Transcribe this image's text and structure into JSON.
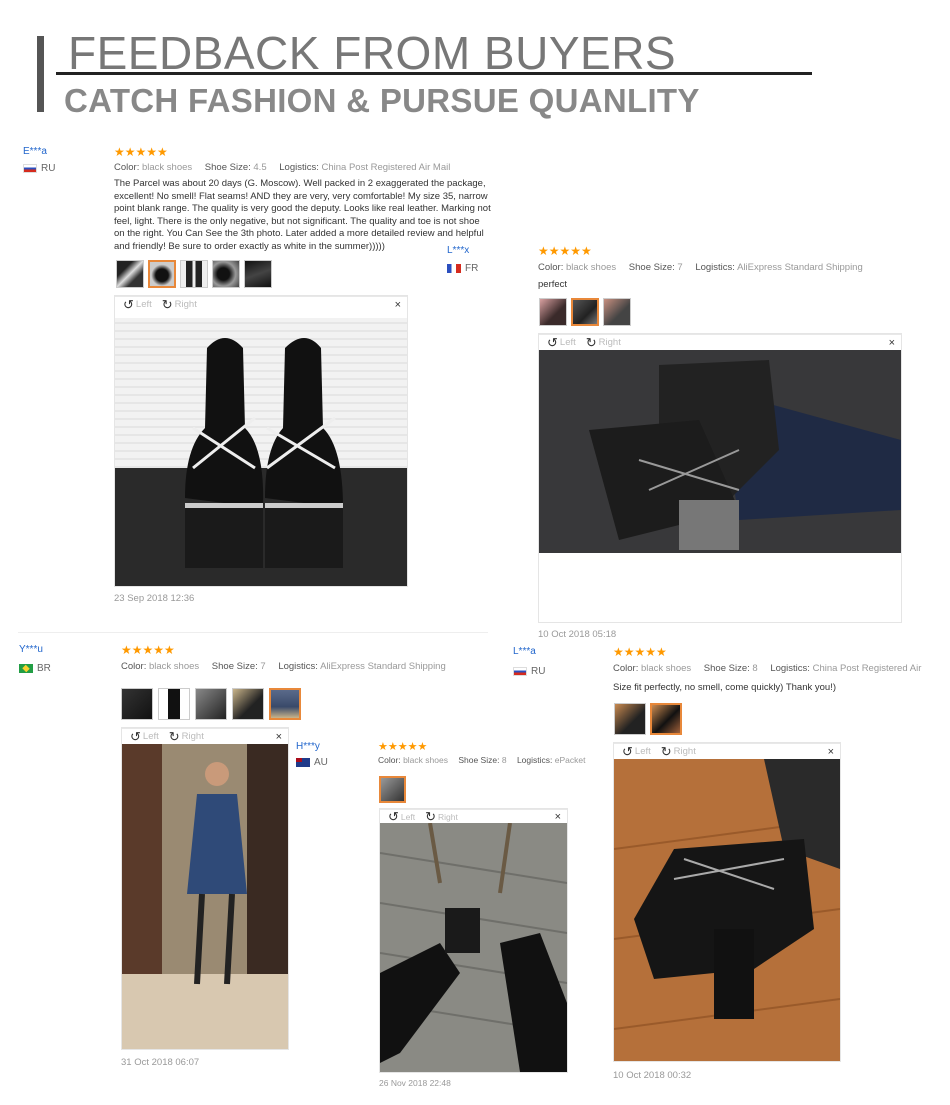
{
  "header": {
    "title": "FEEDBACK FROM BUYERS",
    "subtitle": "CATCH FASHION & PURSUE QUANLITY"
  },
  "toolbar": {
    "left": "Left",
    "right": "Right",
    "close": "×"
  },
  "stars": "★★★★★",
  "labels": {
    "color": "Color:",
    "size": "Shoe Size:",
    "logistics": "Logistics:"
  },
  "reviews": [
    {
      "user": "E***a",
      "country": "RU",
      "color": "black shoes",
      "size": "4.5",
      "logistics": "China Post Registered Air Mail",
      "text": "The Parcel was about 20 days (G. Moscow). Well packed in 2 exaggerated the package, excellent! No smell! Flat seams! AND they are very, very comfortable! My size 35, narrow point blank range. The quality is very good the deputy. Looks like real leather. Marking not feel, light. There is the only negative, but not significant. The quality and toe is not shoe on the right. You Can See the 3th photo. Later added a more detailed review and helpful and friendly! Be sure to order exactly as white in the summer)))))",
      "date": "23 Sep 2018 12:36"
    },
    {
      "user": "L***x",
      "country": "FR",
      "color": "black shoes",
      "size": "7",
      "logistics": "AliExpress Standard Shipping",
      "text": "perfect",
      "date": "10 Oct 2018 05:18"
    },
    {
      "user": "Y***u",
      "country": "BR",
      "color": "black shoes",
      "size": "7",
      "logistics": "AliExpress Standard Shipping",
      "date": "31 Oct 2018 06:07"
    },
    {
      "user": "H***y",
      "country": "AU",
      "color": "black shoes",
      "size": "8",
      "logistics": "ePacket",
      "date": "26 Nov 2018 22:48"
    },
    {
      "user": "L***a",
      "country": "RU",
      "color": "black shoes",
      "size": "8",
      "logistics": "China Post Registered Air",
      "text": "Size fit perfectly, no smell, come quickly) Thank you!)",
      "date": "10 Oct 2018 00:32"
    }
  ],
  "colors": {
    "star": "#ff9900",
    "user": "#2266cc",
    "thumb_selected": "#e8883a"
  }
}
